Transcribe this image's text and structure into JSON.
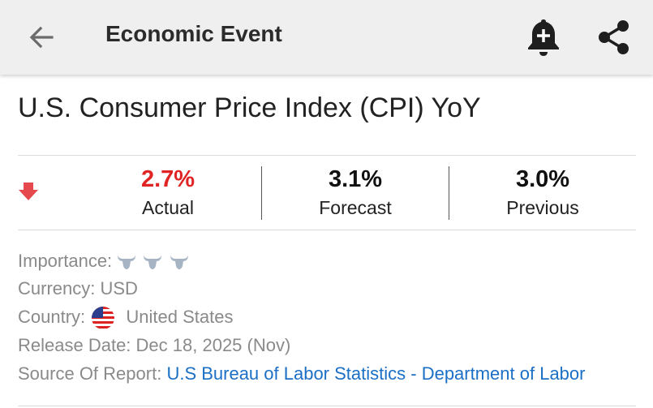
{
  "appbar": {
    "title": "Economic Event",
    "icons": {
      "back": "arrow-left-icon",
      "alert": "bell-plus-icon",
      "share": "share-icon"
    }
  },
  "event": {
    "title": "U.S. Consumer Price Index (CPI) YoY",
    "trend": "down",
    "trend_color": "#e5484d",
    "stats": [
      {
        "value": "2.7%",
        "label": "Actual",
        "color": "#e02424"
      },
      {
        "value": "3.1%",
        "label": "Forecast",
        "color": "#111111"
      },
      {
        "value": "3.0%",
        "label": "Previous",
        "color": "#111111"
      }
    ]
  },
  "details": {
    "importance_label": "Importance:",
    "importance_level": 3,
    "importance_max": 3,
    "currency_label": "Currency:",
    "currency_value": "USD",
    "country_label": "Country:",
    "country_value": "United States",
    "release_label": "Release Date:",
    "release_value": "Dec 18, 2025 (Nov)",
    "source_label": "Source Of Report:",
    "source_value": "U.S Bureau of Labor Statistics - Department of Labor"
  },
  "colors": {
    "link": "#1b6fc5",
    "actual_down": "#e02424",
    "appbar_bg": "#efefef"
  }
}
